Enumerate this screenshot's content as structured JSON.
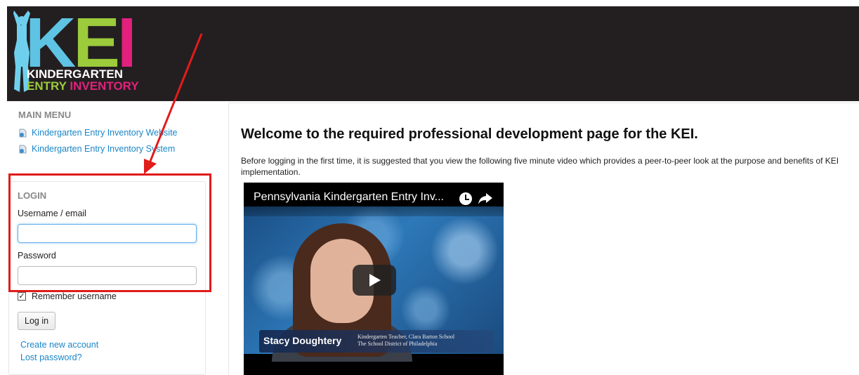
{
  "logo": {
    "letters": [
      "K",
      "E",
      "I"
    ],
    "line1": "KINDERGARTEN",
    "line2a": "ENTRY",
    "line2b": "INVENTORY",
    "colors": {
      "k": "#5fc3e4",
      "e": "#9ccb3b",
      "i": "#e2217d",
      "figure": "#6fd0ee",
      "entry": "#9ccb3b",
      "inventory": "#e2217d"
    }
  },
  "sidebar": {
    "menu_title": "MAIN MENU",
    "menu_items": [
      {
        "label": "Kindergarten Entry Inventory Website",
        "icon": "document-link-icon"
      },
      {
        "label": "Kindergarten Entry Inventory System",
        "icon": "document-link-icon"
      }
    ],
    "login": {
      "title": "LOGIN",
      "username_label": "Username / email",
      "username_value": "",
      "password_label": "Password",
      "password_value": "",
      "remember_label": "Remember username",
      "remember_checked": "✓",
      "login_button": "Log in",
      "create_account": "Create new account",
      "lost_password": "Lost password?"
    }
  },
  "main": {
    "title": "Welcome to the required professional development page for the KEI.",
    "intro": "Before logging in the first time, it is suggested that you view the following five minute video which provides a peer-to-peer look at the purpose and benefits of KEI implementation.",
    "video": {
      "title": "Pennsylvania Kindergarten Entry Inv...",
      "speaker_name": "Stacy Doughtery",
      "speaker_role_1": "Kindergarten Teacher, Clara Barton School",
      "speaker_role_2": "The School District of Philadelphia"
    }
  },
  "annotation": {
    "color": "#e21b1b"
  }
}
